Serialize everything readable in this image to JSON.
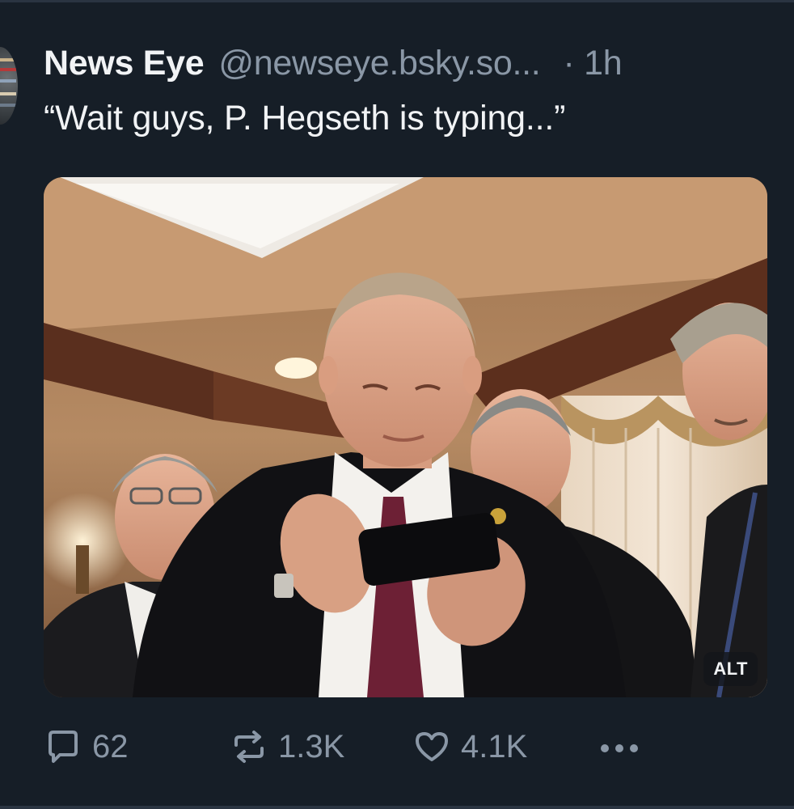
{
  "post": {
    "author": {
      "display_name": "News Eye",
      "handle": "@newseye.bsky.so...",
      "time_separator": "·",
      "time_ago": "1h"
    },
    "text": "“Wait guys, P. Hegseth is typing...”",
    "media": {
      "alt_badge": "ALT"
    },
    "actions": {
      "reply_count": "62",
      "repost_count": "1.3K",
      "like_count": "4.1K",
      "more_icon": "ellipsis-icon"
    }
  },
  "colors": {
    "background": "#161e27",
    "primary_text": "#f1f3f5",
    "secondary_text": "#8a97a6"
  }
}
